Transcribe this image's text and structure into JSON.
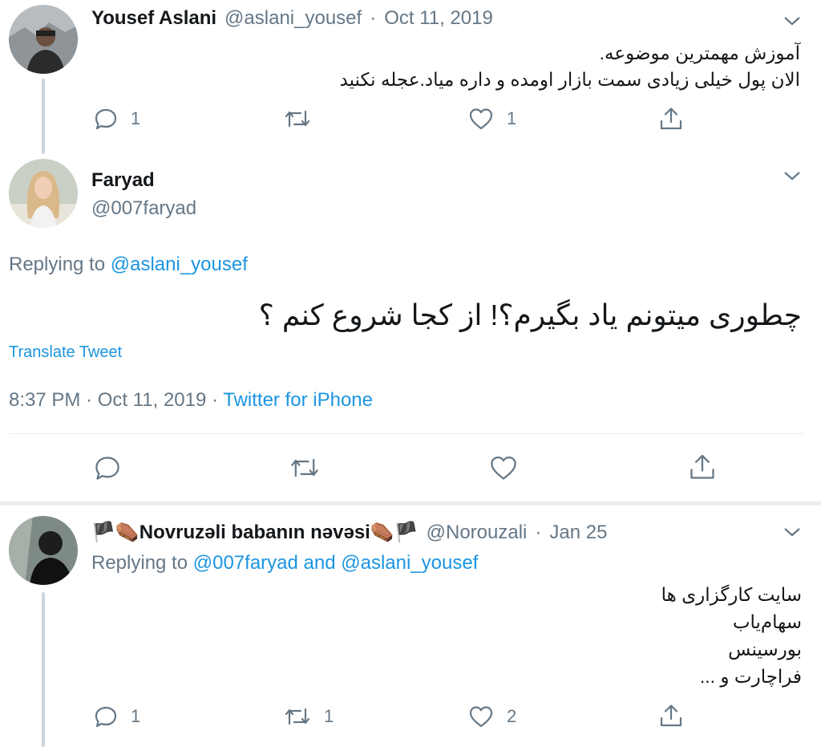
{
  "tweet1": {
    "name": "Yousef Aslani",
    "handle": "@aslani_yousef",
    "sep": "·",
    "date": "Oct 11, 2019",
    "text_line1": "آموزش مهمترین موضوعه.",
    "text_line2": "الان پول خیلی زیادی سمت بازار اومده و داره میاد.عجله نکنید",
    "reply_count": "1",
    "like_count": "1"
  },
  "tweet2": {
    "name": "Faryad",
    "handle": "@007faryad",
    "replying_prefix": "Replying to",
    "replying_to": "@aslani_yousef",
    "text": "چطوری میتونم یاد بگیرم؟! از کجا شروع کنم ؟",
    "translate": "Translate Tweet",
    "time_date": "8:37 PM · Oct 11, 2019 ·",
    "source": "Twitter for iPhone"
  },
  "tweet3": {
    "name": "🏴⚰️Novruzəli babanın nəvəsi⚰️🏴",
    "handle": "@Norouzali",
    "sep": "·",
    "date": "Jan 25",
    "replying_prefix": "Replying to",
    "replying_to": "@007faryad and @aslani_yousef",
    "lines": [
      "سایت کارگزاری ها",
      "سهام‌یاب",
      "بورسینس",
      "فراچارت و ..."
    ],
    "reply_count": "1",
    "retweet_count": "1",
    "like_count": "2"
  },
  "colors": {
    "link": "#1b95e0",
    "secondary": "#657786",
    "primary": "#14171a",
    "divider": "#e6ecf0"
  }
}
